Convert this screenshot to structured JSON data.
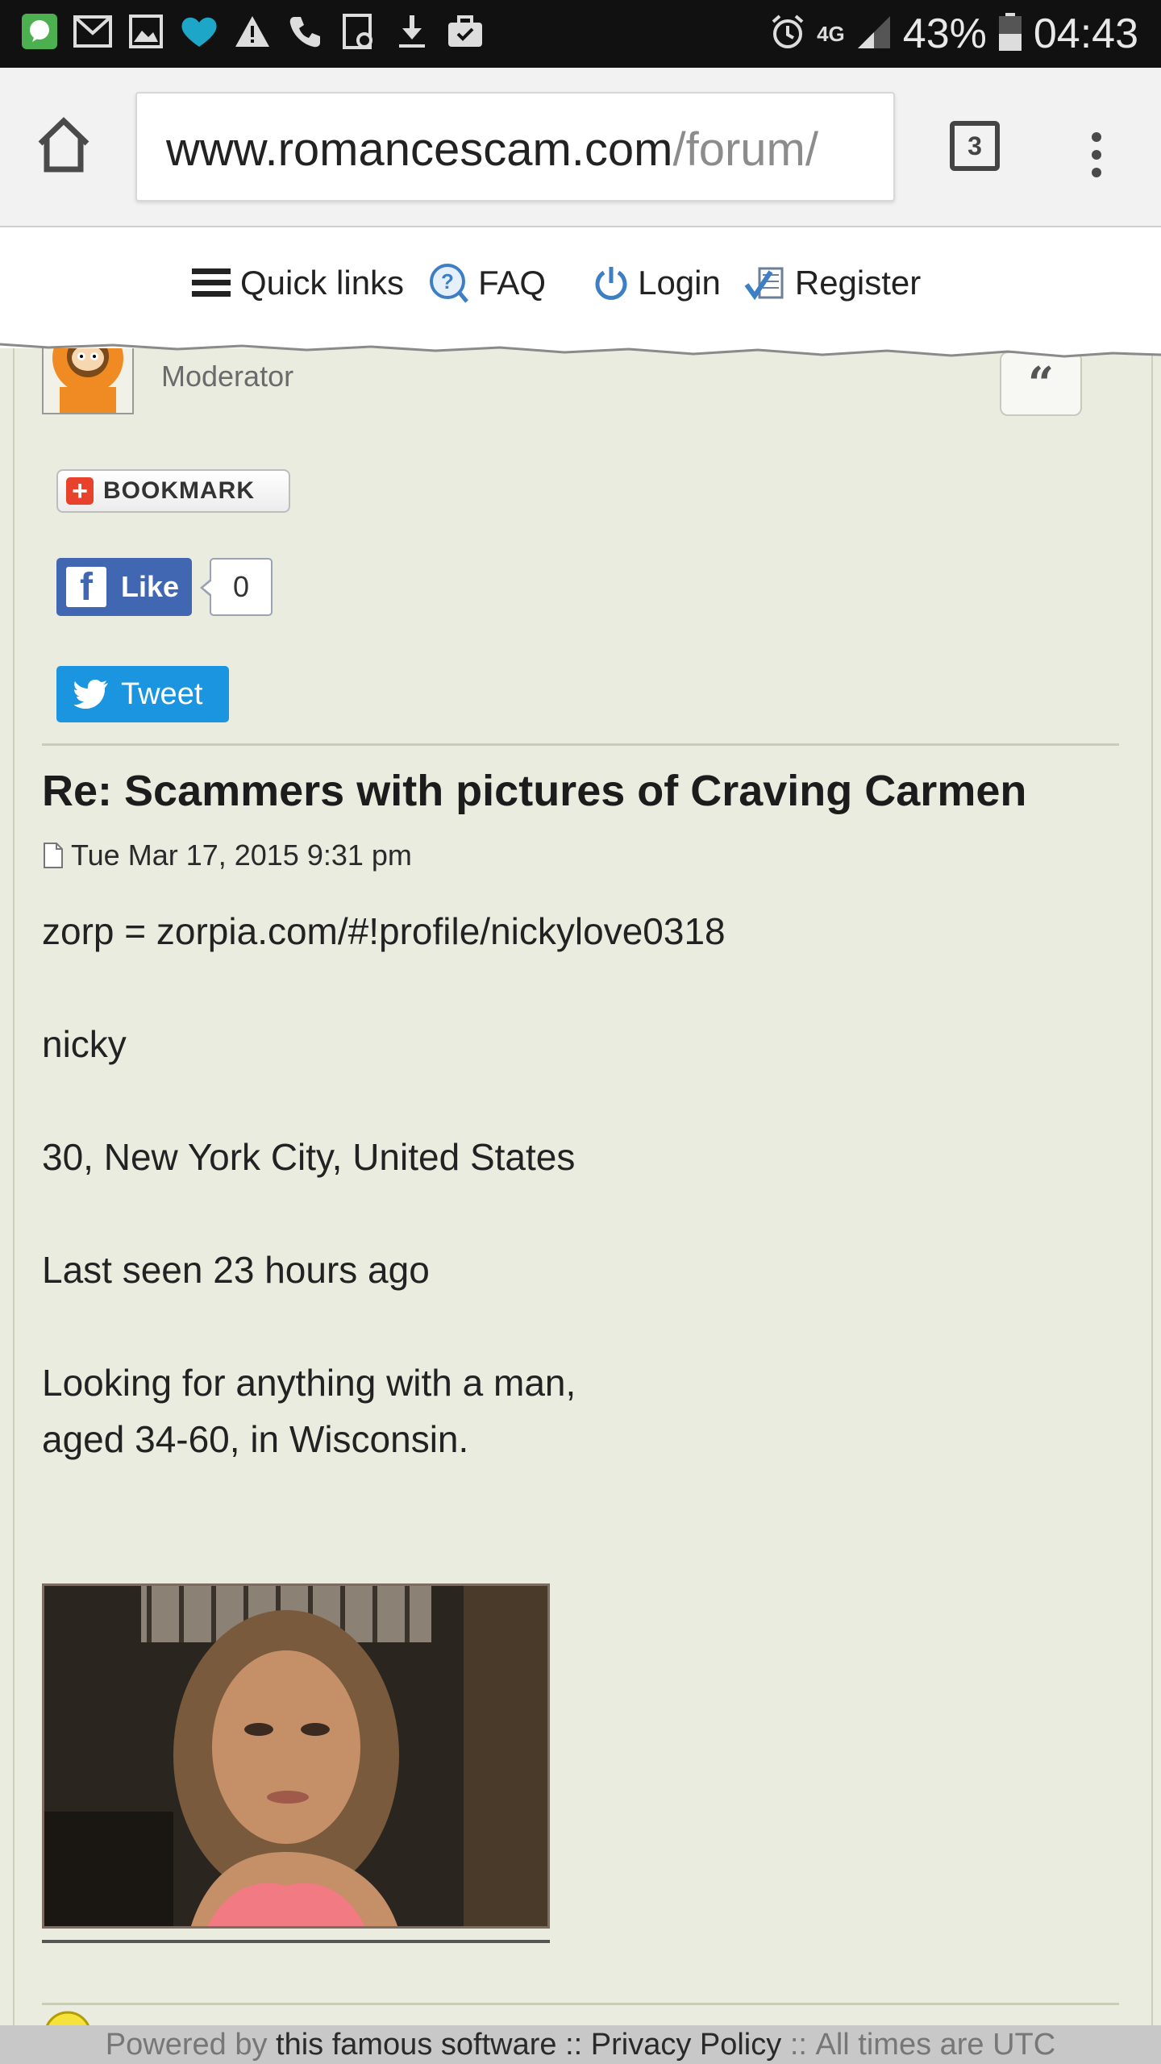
{
  "status_bar": {
    "battery_percent": "43%",
    "time": "04:43",
    "network": "4G",
    "icons": [
      "hangouts-icon",
      "gmail-icon",
      "gallery-icon",
      "heart-icon",
      "warning-icon",
      "phone-icon",
      "screenshot-icon",
      "download-icon",
      "briefcase-icon"
    ]
  },
  "browser": {
    "url_domain": "www.romancescam.com",
    "url_path": "/forum/",
    "tab_count": "3"
  },
  "topnav": {
    "items": [
      {
        "label": "Quick links",
        "icon": "hamburger-icon"
      },
      {
        "label": "FAQ",
        "icon": "faq-icon"
      },
      {
        "label": "Login",
        "icon": "power-icon"
      },
      {
        "label": "Register",
        "icon": "register-icon"
      }
    ]
  },
  "post_author": {
    "rank": "Moderator"
  },
  "social": {
    "bookmark_label": "BOOKMARK",
    "like_label": "Like",
    "like_count": "0",
    "tweet_label": "Tweet"
  },
  "post": {
    "title": "Re: Scammers with pictures of Craving Carmen",
    "date": "Tue Mar 17, 2015 9:31 pm",
    "body": [
      "zorp = zorpia.com/#!profile/nickylove0318",
      "nicky",
      "30, New York City, United States",
      "Last seen 23 hours ago",
      "Looking for anything with a man,",
      "aged 34-60, in Wisconsin."
    ]
  },
  "footer": {
    "powered_by": "Powered by",
    "software": "this famous software",
    "sep1": "::",
    "privacy": "Privacy Policy",
    "sep2": "::",
    "times": "All times are UTC"
  },
  "colors": {
    "content_bg": "#e9ecdf",
    "facebook": "#4267b2",
    "twitter": "#1b95e0",
    "bookmark_red": "#e8412c"
  }
}
